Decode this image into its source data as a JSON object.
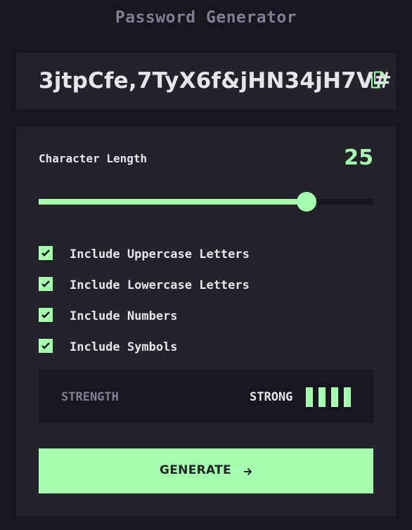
{
  "app": {
    "title": "Password Generator"
  },
  "password": {
    "value": "3jtpCfe,7TyX6f&jHN34jH7V#",
    "copy_icon": "copy-icon"
  },
  "length": {
    "label": "Character Length",
    "value": "25",
    "slider_fraction": 0.8
  },
  "options": [
    {
      "label": "Include Uppercase Letters",
      "checked": true
    },
    {
      "label": "Include Lowercase Letters",
      "checked": true
    },
    {
      "label": "Include Numbers",
      "checked": true
    },
    {
      "label": "Include Symbols",
      "checked": true
    }
  ],
  "strength": {
    "label": "STRENGTH",
    "value": "STRONG",
    "level": 4,
    "max_level": 4
  },
  "generate": {
    "label": "GENERATE",
    "icon": "arrow-right-icon"
  },
  "colors": {
    "background": "#18171f",
    "panel": "#24232c",
    "accent": "#a4ffaf",
    "muted": "#817d92",
    "text": "#e6e5ea"
  }
}
